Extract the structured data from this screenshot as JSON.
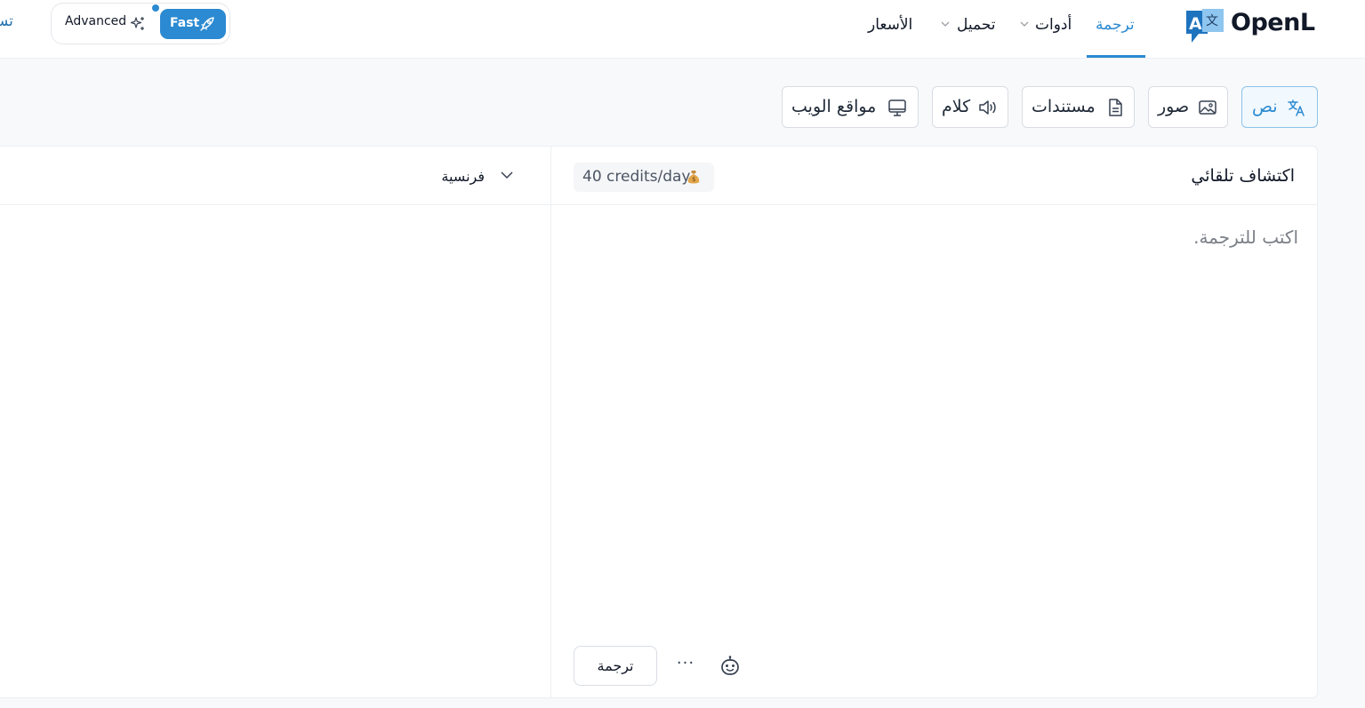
{
  "brand": {
    "name": "OpenL",
    "logo_glyph_a": "A",
    "logo_glyph_b": "文"
  },
  "nav": {
    "items": [
      {
        "label": "ترجمة",
        "active": true
      },
      {
        "label": "أدوات",
        "has_dropdown": true
      },
      {
        "label": "تحميل",
        "has_dropdown": true
      },
      {
        "label": "الأسعار"
      }
    ],
    "signup_partial": "تسج"
  },
  "mode_toggle": {
    "advanced_label": "Advanced",
    "fast_label": "Fast",
    "selected": "Fast"
  },
  "tabs": [
    {
      "label": "نص",
      "icon": "translate-icon",
      "active": true
    },
    {
      "label": "صور",
      "icon": "image-icon"
    },
    {
      "label": "مستندات",
      "icon": "document-icon"
    },
    {
      "label": "كلام",
      "icon": "speaker-icon"
    },
    {
      "label": "مواقع الويب",
      "icon": "monitor-icon"
    }
  ],
  "source": {
    "language": "اكتشاف تلقائي",
    "placeholder": "اكتب للترجمة.",
    "value": ""
  },
  "credits": {
    "label": "40 credits/day",
    "icon": "money-bag-icon"
  },
  "target": {
    "language": "فرنسية"
  },
  "actions": {
    "translate_label": "ترجمة",
    "more_label": "···",
    "bot_icon": "robot-icon"
  },
  "colors": {
    "accent": "#2b8ad1",
    "border": "#d9dde3",
    "text": "#111827"
  }
}
